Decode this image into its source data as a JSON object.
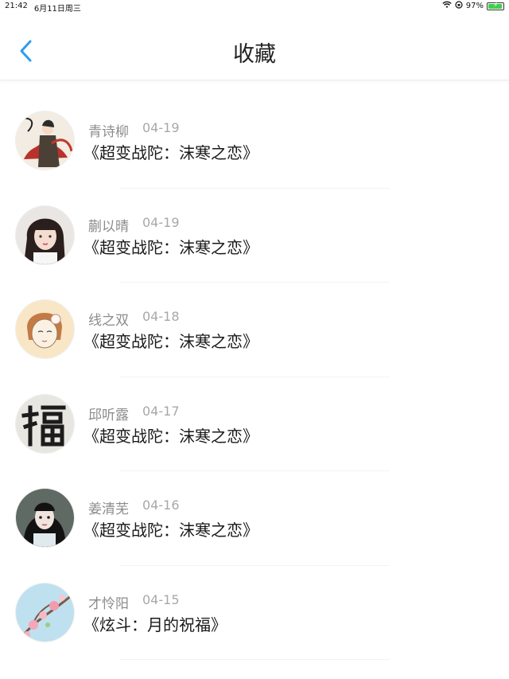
{
  "status": {
    "time": "21:42",
    "date": "6月11日周三",
    "battery": "97%",
    "battery_level": 0.97
  },
  "header": {
    "title": "收藏",
    "back_icon": "chevron-left-icon"
  },
  "favorites": [
    {
      "author": "青诗柳",
      "date": "04-19",
      "title": "《超变战陀：沫寒之恋》",
      "avatar": "avatar-ink-warrior"
    },
    {
      "author": "蒯以晴",
      "date": "04-19",
      "title": "《超变战陀：沫寒之恋》",
      "avatar": "avatar-girl-bangs"
    },
    {
      "author": "线之双",
      "date": "04-18",
      "title": "《超变战陀：沫寒之恋》",
      "avatar": "avatar-sketch-girl"
    },
    {
      "author": "邱听露",
      "date": "04-17",
      "title": "《超变战陀：沫寒之恋》",
      "avatar": "avatar-fu-character"
    },
    {
      "author": "姜清芜",
      "date": "04-16",
      "title": "《超变战陀：沫寒之恋》",
      "avatar": "avatar-dark-hair-girl"
    },
    {
      "author": "才怜阳",
      "date": "04-15",
      "title": "《炫斗：月的祝福》",
      "avatar": "avatar-blossom"
    }
  ],
  "colors": {
    "accent": "#2d9cf0",
    "meta": "#8c8c8c",
    "title": "#1a1a1a"
  }
}
